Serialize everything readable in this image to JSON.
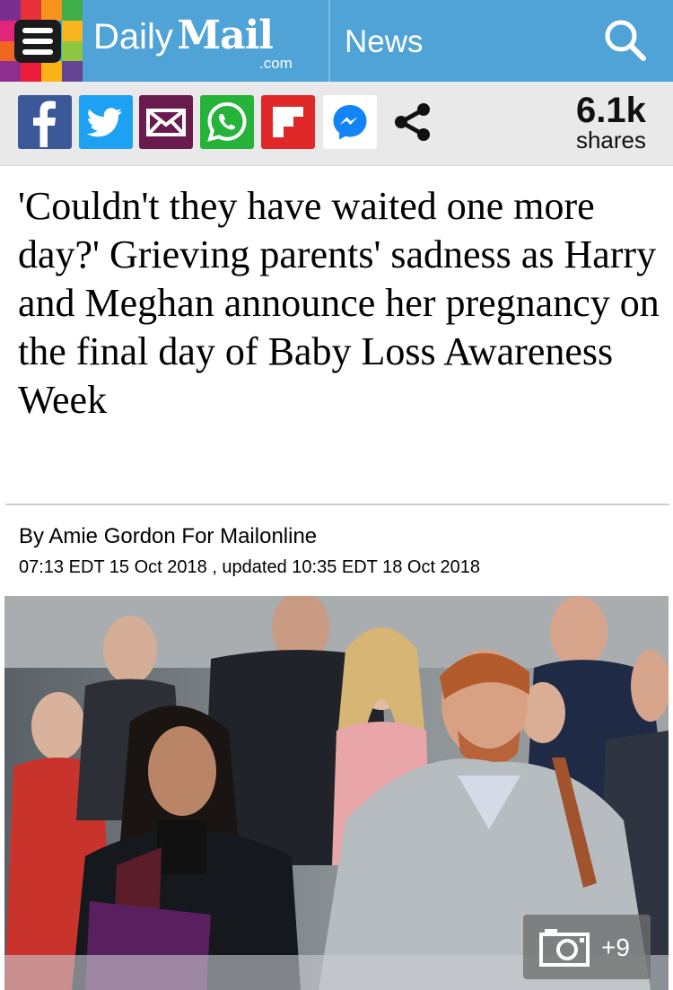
{
  "header": {
    "brand_daily": "Daily",
    "brand_mail": "Mail",
    "brand_domain": ".com",
    "section": "News",
    "bg_color": "#4fa3d6"
  },
  "logo_colors": [
    "#7a2e8e",
    "#e8303b",
    "#f7941d",
    "#3fae49",
    "#e0257a",
    "#5b4ea2",
    "#1ba7e0",
    "#f8b520",
    "#f16522",
    "#c2207e",
    "#28b6d7",
    "#8ec63f",
    "#8e2f8f",
    "#ec1c3a",
    "#fcb316",
    "#654496"
  ],
  "share_bar": {
    "buttons": [
      {
        "name": "facebook",
        "icon": "facebook-icon",
        "color": "#3b5998"
      },
      {
        "name": "twitter",
        "icon": "twitter-icon",
        "color": "#1da1f2"
      },
      {
        "name": "email",
        "icon": "email-icon",
        "color": "#6a1b4d"
      },
      {
        "name": "whatsapp",
        "icon": "whatsapp-icon",
        "color": "#25b33a"
      },
      {
        "name": "flipboard",
        "icon": "flipboard-icon",
        "color": "#e12828"
      },
      {
        "name": "messenger",
        "icon": "messenger-icon",
        "color": "#0084ff"
      },
      {
        "name": "share",
        "icon": "share-icon",
        "color": "#111111"
      }
    ],
    "share_count": "6.1k",
    "share_label": "shares"
  },
  "article": {
    "headline": "'Couldn't they have waited one more day?' Grieving parents' sadness as Harry and Meghan announce her pregnancy on the final day of Baby Loss Awareness Week",
    "byline": "By Amie Gordon For Mailonline",
    "dates": "07:13 EDT 15 Oct 2018 , updated 10:35 EDT 18 Oct 2018"
  },
  "photo": {
    "gallery_icon": "camera-icon",
    "gallery_count": "+9"
  }
}
